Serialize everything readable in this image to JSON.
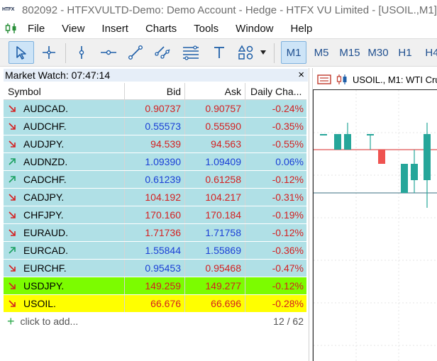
{
  "titlebar": {
    "logo_text": "HTFX",
    "title": "802092 - HTFXVULTD-Demo: Demo Account - Hedge - HTFX VU Limited - [USOIL.,M1]"
  },
  "menu": [
    "File",
    "View",
    "Insert",
    "Charts",
    "Tools",
    "Window",
    "Help"
  ],
  "toolbar": {
    "tools": [
      "cursor",
      "crosshair",
      "vertical-line",
      "horizontal-line",
      "trend-line",
      "equidistant-channel",
      "fibonacci",
      "text",
      "shapes"
    ],
    "timeframes": [
      "M1",
      "M5",
      "M15",
      "M30",
      "H1",
      "H4"
    ],
    "selected_timeframe": "M1"
  },
  "market_watch": {
    "title": "Market Watch: 07:47:14",
    "close_glyph": "×",
    "columns": {
      "symbol": "Symbol",
      "bid": "Bid",
      "ask": "Ask",
      "change": "Daily Cha..."
    },
    "rows": [
      {
        "symbol": "AUDCAD.",
        "bid": "0.90737",
        "ask": "0.90757",
        "change": "-0.24%",
        "direction": "down",
        "bid_color": "#d42020",
        "ask_color": "#d42020",
        "row_bg": "#b0e0e6"
      },
      {
        "symbol": "AUDCHF.",
        "bid": "0.55573",
        "ask": "0.55590",
        "change": "-0.35%",
        "direction": "down",
        "bid_color": "#1a3fd6",
        "ask_color": "#d42020",
        "row_bg": "#b0e0e6"
      },
      {
        "symbol": "AUDJPY.",
        "bid": "94.539",
        "ask": "94.563",
        "change": "-0.55%",
        "direction": "down",
        "bid_color": "#d42020",
        "ask_color": "#d42020",
        "row_bg": "#b0e0e6"
      },
      {
        "symbol": "AUDNZD.",
        "bid": "1.09390",
        "ask": "1.09409",
        "change": "0.06%",
        "direction": "up",
        "bid_color": "#1a3fd6",
        "ask_color": "#1a3fd6",
        "row_bg": "#b0e0e6"
      },
      {
        "symbol": "CADCHF.",
        "bid": "0.61239",
        "ask": "0.61258",
        "change": "-0.12%",
        "direction": "up",
        "bid_color": "#1a3fd6",
        "ask_color": "#d42020",
        "row_bg": "#b0e0e6"
      },
      {
        "symbol": "CADJPY.",
        "bid": "104.192",
        "ask": "104.217",
        "change": "-0.31%",
        "direction": "down",
        "bid_color": "#d42020",
        "ask_color": "#d42020",
        "row_bg": "#b0e0e6"
      },
      {
        "symbol": "CHFJPY.",
        "bid": "170.160",
        "ask": "170.184",
        "change": "-0.19%",
        "direction": "down",
        "bid_color": "#d42020",
        "ask_color": "#d42020",
        "row_bg": "#b0e0e6"
      },
      {
        "symbol": "EURAUD.",
        "bid": "1.71736",
        "ask": "1.71758",
        "change": "-0.12%",
        "direction": "down",
        "bid_color": "#d42020",
        "ask_color": "#1a3fd6",
        "row_bg": "#b0e0e6"
      },
      {
        "symbol": "EURCAD.",
        "bid": "1.55844",
        "ask": "1.55869",
        "change": "-0.36%",
        "direction": "up",
        "bid_color": "#1a3fd6",
        "ask_color": "#1a3fd6",
        "row_bg": "#b0e0e6"
      },
      {
        "symbol": "EURCHF.",
        "bid": "0.95453",
        "ask": "0.95468",
        "change": "-0.47%",
        "direction": "down",
        "bid_color": "#1a3fd6",
        "ask_color": "#d42020",
        "row_bg": "#b0e0e6"
      },
      {
        "symbol": "USDJPY.",
        "bid": "149.259",
        "ask": "149.277",
        "change": "-0.12%",
        "direction": "down",
        "bid_color": "#d42020",
        "ask_color": "#d42020",
        "row_bg": "#7cfc00"
      },
      {
        "symbol": "USOIL.",
        "bid": "66.676",
        "ask": "66.696",
        "change": "-0.28%",
        "direction": "down",
        "bid_color": "#d42020",
        "ask_color": "#d42020",
        "row_bg": "#ffff00"
      }
    ],
    "add_text": "click to add...",
    "count": "12 / 62",
    "change_color": "#d42020",
    "change_color_positive": "#1a3fd6"
  },
  "chart": {
    "title": "USOIL., M1:  WTI Cru",
    "bull_color": "#26a69a",
    "bear_color": "#ef5350",
    "line_color": "#e05050"
  },
  "colors": {
    "arrow_down": "#d42020",
    "arrow_up": "#1aa060"
  }
}
